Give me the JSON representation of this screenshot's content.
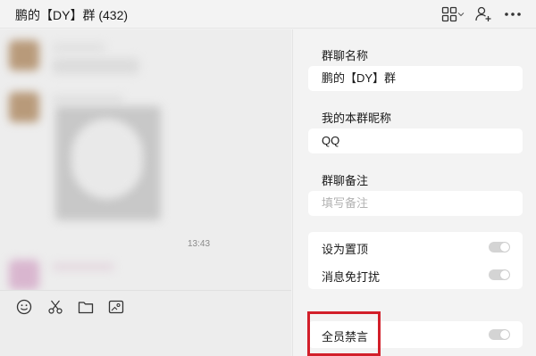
{
  "header": {
    "title": "鹏的【DY】群 (432)",
    "icons": [
      "apps-grid-icon",
      "chevron-down-icon",
      "add-member-icon",
      "more-icon"
    ]
  },
  "chat": {
    "timestamp": "13:43"
  },
  "toolbar": {
    "icons": [
      "emoji-icon",
      "scissors-icon",
      "folder-icon",
      "screenshot-icon"
    ]
  },
  "panel": {
    "group_name_label": "群聊名称",
    "group_name_value": "鹏的【DY】群",
    "nickname_label": "我的本群昵称",
    "nickname_value": "QQ",
    "remark_label": "群聊备注",
    "remark_placeholder": "填写备注",
    "pin_label": "设为置顶",
    "pin_on": false,
    "mute_label": "消息免打扰",
    "mute_on": false,
    "all_mute_label": "全员禁言",
    "all_mute_on": false
  },
  "colors": {
    "highlight": "#d21f2a",
    "panel_bg": "#f3f3f3",
    "card_bg": "#ffffff"
  }
}
